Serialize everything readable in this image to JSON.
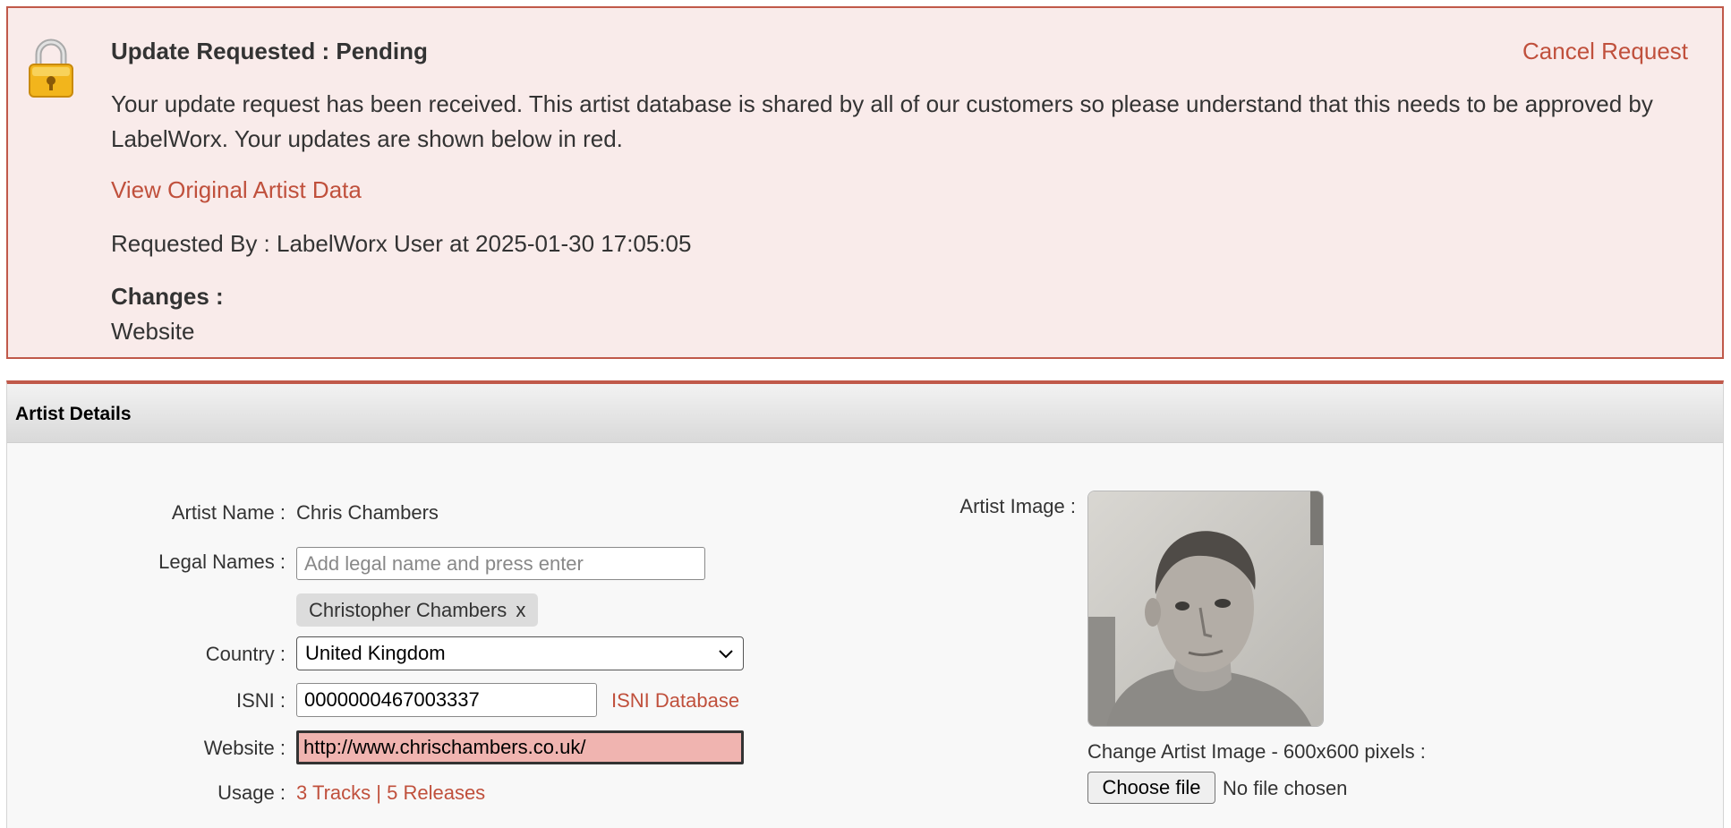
{
  "notice": {
    "title": "Update Requested : Pending",
    "cancel_label": "Cancel Request",
    "message": "Your update request has been received. This artist database is shared by all of our customers so please understand that this needs to be approved by LabelWorx. Your updates are shown below in red.",
    "view_original_label": "View Original Artist Data",
    "requested_by": "Requested By : LabelWorx User at 2025-01-30 17:05:05",
    "changes_title": "Changes :",
    "changes": [
      "Website"
    ],
    "icon": "padlock-icon"
  },
  "panel": {
    "title": "Artist Details"
  },
  "form": {
    "artist_name_label": "Artist Name :",
    "artist_name": "Chris Chambers",
    "legal_names_label": "Legal Names :",
    "legal_names_placeholder": "Add legal name and press enter",
    "legal_names_tags": [
      {
        "label": "Christopher Chambers",
        "remove": "x"
      }
    ],
    "country_label": "Country :",
    "country_value": "United Kingdom",
    "isni_label": "ISNI :",
    "isni_value": "0000000467003337",
    "isni_link": "ISNI Database",
    "website_label": "Website :",
    "website_value": "http://www.chrischambers.co.uk/",
    "usage_label": "Usage :",
    "usage_tracks": "3 Tracks",
    "usage_separator": "|",
    "usage_releases": "5 Releases",
    "artist_image_label": "Artist Image :",
    "change_image_label": "Change Artist Image - 600x600 pixels :",
    "choose_file_label": "Choose file",
    "no_file_label": "No file chosen"
  },
  "colors": {
    "accent": "#c0503c",
    "notice_bg": "#f9ebea",
    "changed_field_bg": "#f0b4b0"
  }
}
